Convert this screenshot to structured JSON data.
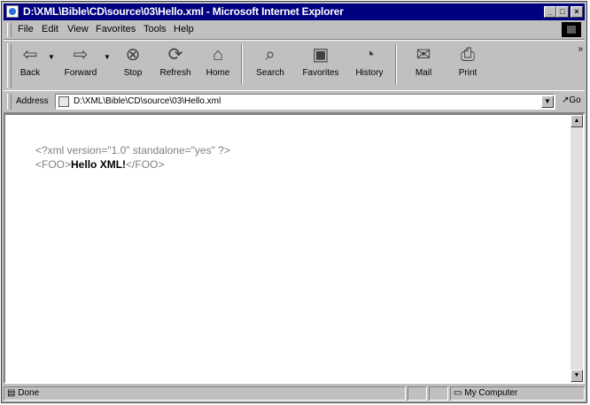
{
  "window": {
    "title": "D:\\XML\\Bible\\CD\\source\\03\\Hello.xml - Microsoft Internet Explorer",
    "controls": [
      "minimize-icon",
      "maximize-icon",
      "close-icon"
    ]
  },
  "menu": {
    "file": "File",
    "edit": "Edit",
    "view": "View",
    "favorites": "Favorites",
    "tools": "Tools",
    "help": "Help"
  },
  "toolbar": {
    "back": "Back",
    "forward": "Forward",
    "stop": "Stop",
    "refresh": "Refresh",
    "home": "Home",
    "search": "Search",
    "favorites": "Favorites",
    "history": "History",
    "mail": "Mail",
    "print": "Print"
  },
  "address": {
    "label": "Address",
    "value": "D:\\XML\\Bible\\CD\\source\\03\\Hello.xml",
    "go": "Go"
  },
  "document": {
    "declaration": "<?xml version=\"1.0\" standalone=\"yes\" ?>",
    "open_tag": "<FOO>",
    "content": "Hello XML!",
    "close_tag": "</FOO>"
  },
  "status": {
    "text": "Done",
    "zone": "My Computer"
  }
}
